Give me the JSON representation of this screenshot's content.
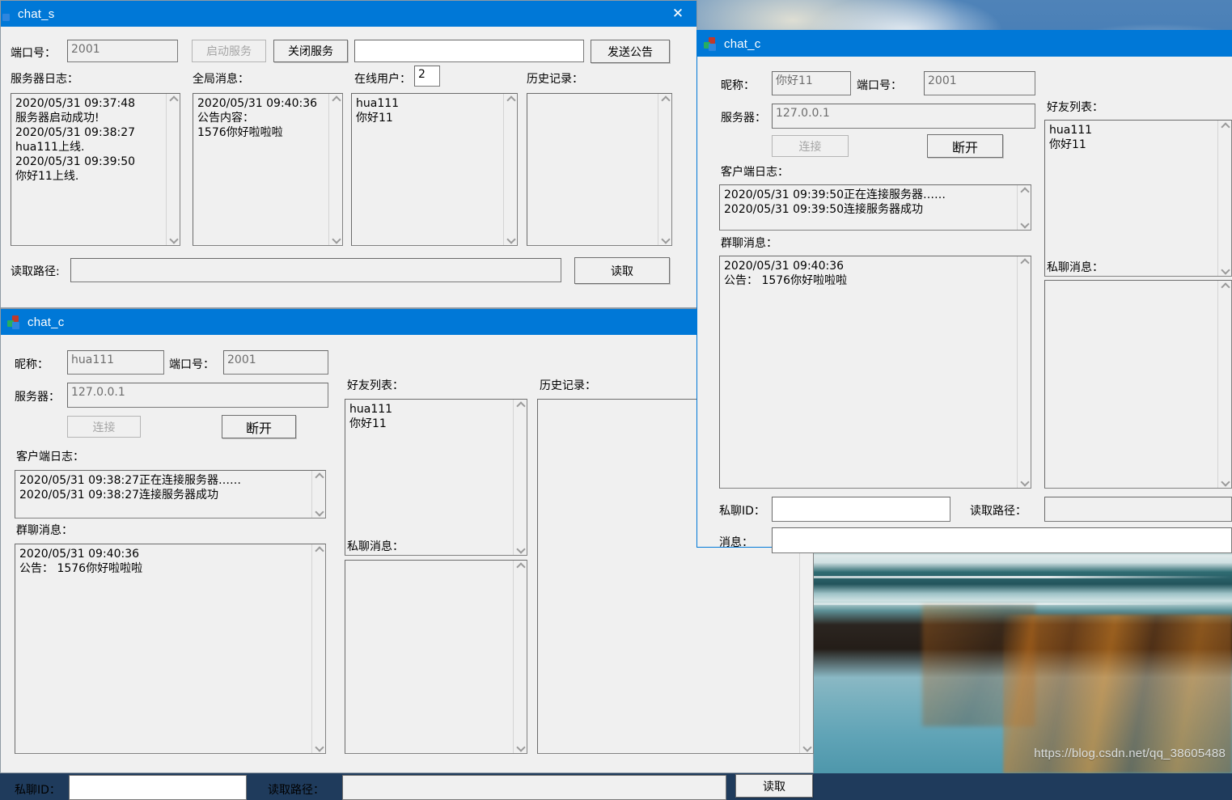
{
  "desktop": {
    "watermark": "https://blog.csdn.net/qq_38605488"
  },
  "server_window": {
    "title": "chat_s",
    "close_label": "✕",
    "port_label": "端口号：",
    "port_value": "2001",
    "start_button": "启动服务",
    "stop_button": "关闭服务",
    "announce_input": "",
    "announce_button": "发送公告",
    "server_log_label": "服务器日志：",
    "server_log_text": "2020/05/31 09:37:48\n服务器启动成功!\n2020/05/31 09:38:27\nhua111上线.\n2020/05/31 09:39:50\n你好11上线.",
    "global_msg_label": "全局消息：",
    "global_msg_text": "2020/05/31 09:40:36\n公告内容：\n1576你好啦啦啦",
    "online_users_label": "在线用户：",
    "online_users_count": "2",
    "online_users_text": "hua111\n你好11",
    "history_label": "历史记录：",
    "history_text": "",
    "read_path_label": "读取路径:",
    "read_path_value": "",
    "read_button": "读取"
  },
  "client_window_back": {
    "title": "chat_c",
    "nickname_label": "昵称：",
    "nickname_value": "hua111",
    "port_label": "端口号：",
    "port_value": "2001",
    "server_label": "服务器：",
    "server_value": "127.0.0.1",
    "connect_button": "连接",
    "disconnect_button": "断开",
    "client_log_label": "客户端日志：",
    "client_log_text": "2020/05/31 09:38:27正在连接服务器……\n2020/05/31 09:38:27连接服务器成功",
    "group_msg_label": "群聊消息：",
    "group_msg_text": "2020/05/31 09:40:36\n公告： 1576你好啦啦啦",
    "friends_label": "好友列表：",
    "friends_text": "hua111\n你好11",
    "private_msg_label": "私聊消息：",
    "private_msg_text": "",
    "history_label": "历史记录：",
    "history_text": "",
    "private_id_label": "私聊ID：",
    "private_id_value": "",
    "read_path_label": "读取路径：",
    "read_path_value": "",
    "read_button": "读取"
  },
  "client_window_front": {
    "title": "chat_c",
    "nickname_label": "昵称：",
    "nickname_value": "你好11",
    "port_label": "端口号：",
    "port_value": "2001",
    "server_label": "服务器：",
    "server_value": "127.0.0.1",
    "connect_button": "连接",
    "disconnect_button": "断开",
    "client_log_label": "客户端日志：",
    "client_log_text": "2020/05/31 09:39:50正在连接服务器……\n2020/05/31 09:39:50连接服务器成功",
    "group_msg_label": "群聊消息：",
    "group_msg_text": "2020/05/31 09:40:36\n公告： 1576你好啦啦啦",
    "friends_label": "好友列表：",
    "friends_text": "hua111\n你好11",
    "private_msg_label": "私聊消息：",
    "private_msg_text": "",
    "private_id_label": "私聊ID：",
    "private_id_value": "",
    "read_path_label": "读取路径：",
    "read_path_value": "",
    "message_label": "消息：",
    "message_value": ""
  }
}
